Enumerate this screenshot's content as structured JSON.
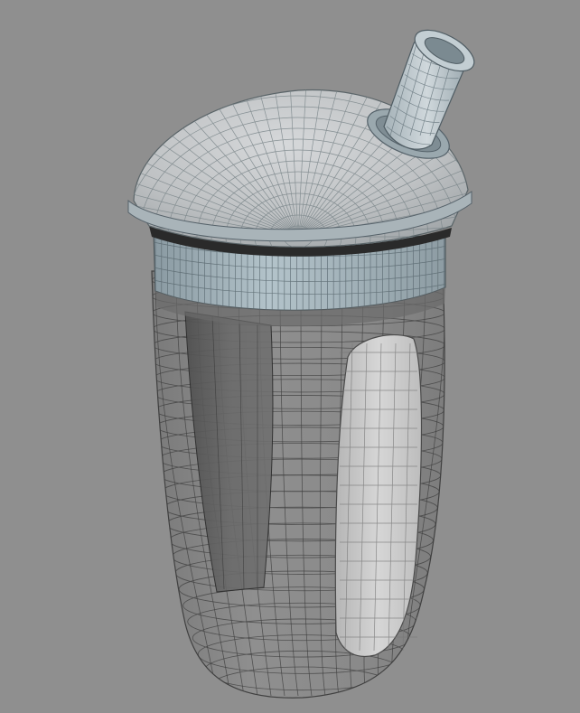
{
  "viewport": {
    "background": "#8f8f8f",
    "shading": "wireframe-on-shaded",
    "subject": "sippy-cup-model"
  },
  "colors": {
    "body_glass": "#8c8c8c",
    "body_glass_dark": "#5a5a5a",
    "wire_dark": "#3a3a3a",
    "lid_fill": "#b8b8b8",
    "lid_wire": "#6f7a80",
    "band_fill": "#9fb0b8",
    "handle_fill": "#c9c9c9",
    "inner_panel": "#5f5f5f"
  }
}
